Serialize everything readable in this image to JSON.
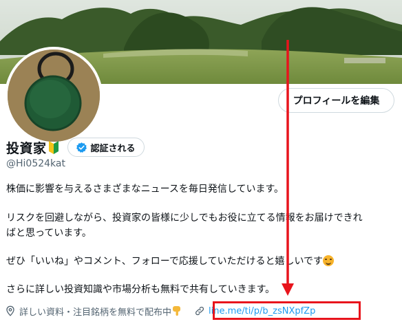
{
  "colors": {
    "accent": "#1d9bf0",
    "annotation": "#e8141c",
    "muted": "#536471"
  },
  "profile": {
    "edit_button_label": "プロフィールを編集",
    "display_name": "投資家",
    "name_badge_icon": "beginner-mark-icon",
    "verify_label": "認証される",
    "verify_icon": "verified-check-icon",
    "handle": "@Hi0524kat"
  },
  "bio": {
    "line1": "株価に影響を与えるさまざまなニュースを毎日発信しています。",
    "line2": "リスクを回避しながら、投資家の皆様に少しでもお役に立てる情報をお届けできれ",
    "line3": "ばと思っています。",
    "line4": "ぜひ「いいね」やコメント、フォローで応援していただけると嬉しいです",
    "line5": "さらに詳しい投資知識や市場分析も無料で共有していきます。"
  },
  "meta": {
    "location_icon": "location-pin-icon",
    "location_text": "詳しい資料・注目銘柄を無料で配布中",
    "link_icon": "link-icon",
    "link_text": "line.me/ti/p/b_zsNXpfZp"
  }
}
